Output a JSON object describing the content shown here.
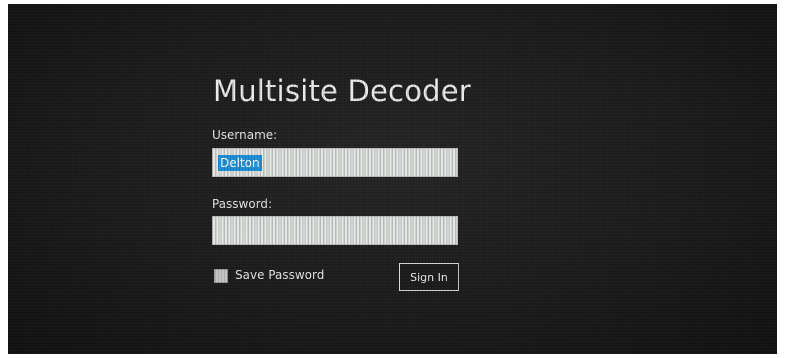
{
  "app": {
    "title": "Multisite Decoder"
  },
  "login_form": {
    "username_label": "Username:",
    "username_value": "Delton",
    "password_label": "Password:",
    "password_value": "",
    "save_password_label": "Save Password",
    "save_password_checked": false,
    "sign_in_label": "Sign In"
  },
  "colors": {
    "background": "#1c1c1c",
    "text": "#e9e9e9",
    "selection": "#1f8fd8"
  }
}
